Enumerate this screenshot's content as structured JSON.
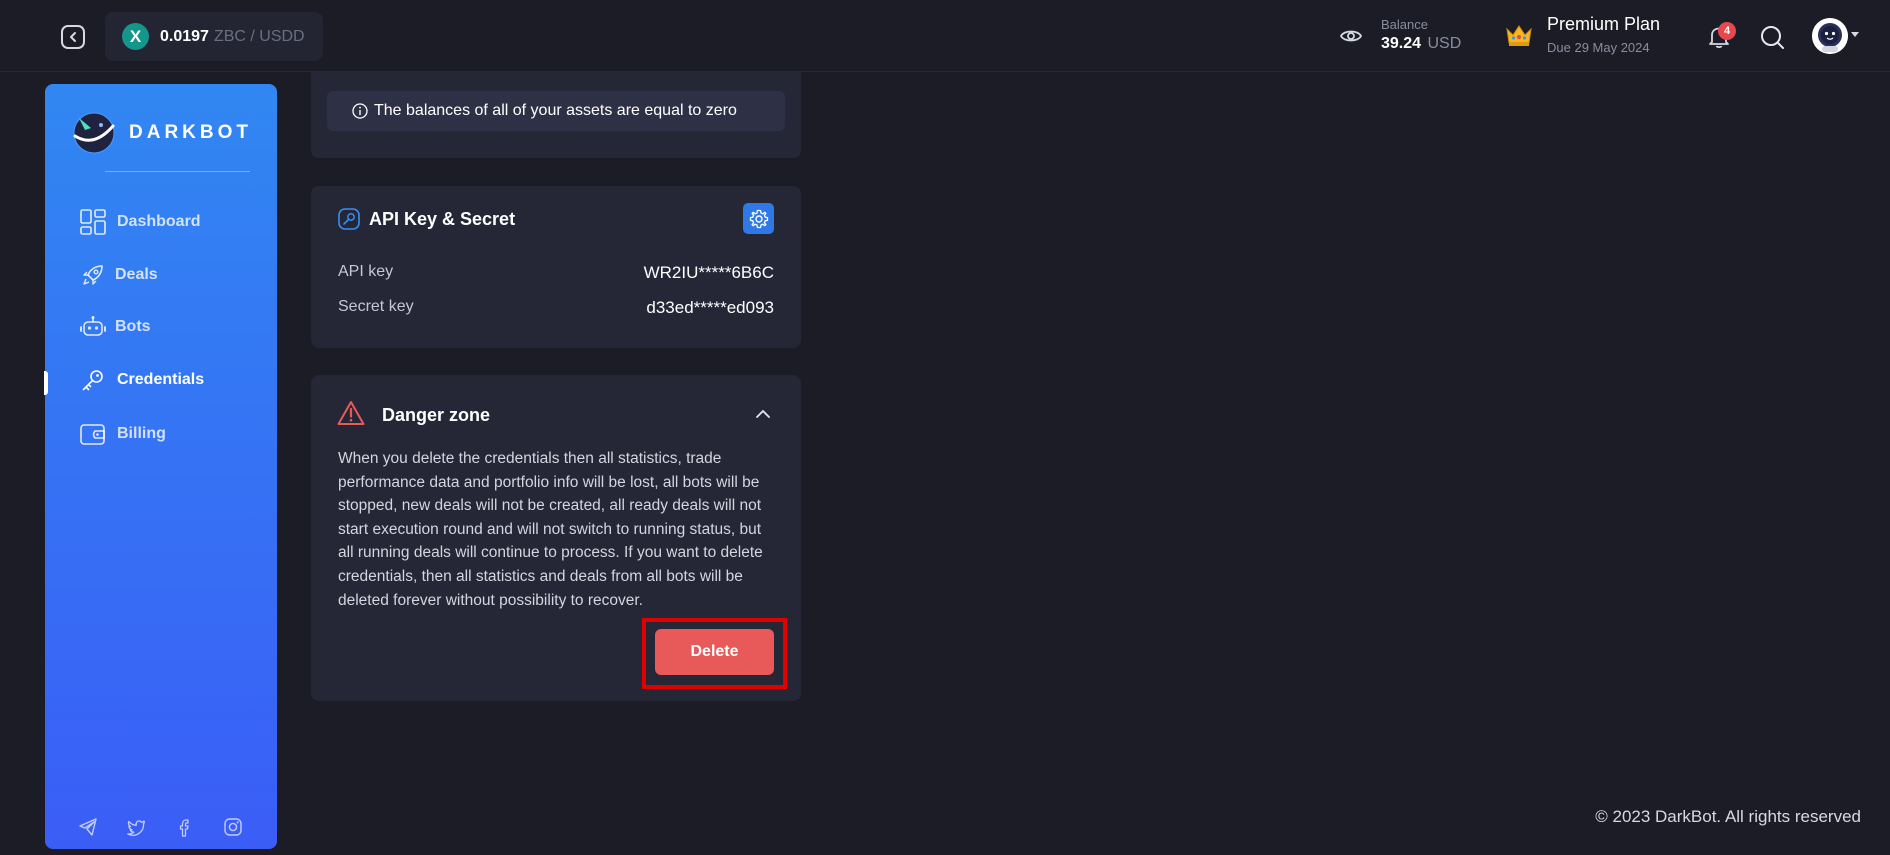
{
  "header": {
    "ticker": {
      "price": "0.0197",
      "pair": "ZBC / USDD",
      "coin_icon": "zbc-coin-icon",
      "coin_letter": "X"
    },
    "balance": {
      "label": "Balance",
      "value": "39.24",
      "currency": "USD"
    },
    "plan": {
      "name": "Premium Plan",
      "due": "Due 29 May 2024"
    },
    "notifications_count": "4"
  },
  "sidebar": {
    "brand": "DARKBOT",
    "items": [
      {
        "label": "Dashboard",
        "icon": "dashboard-icon"
      },
      {
        "label": "Deals",
        "icon": "rocket-icon"
      },
      {
        "label": "Bots",
        "icon": "robot-icon"
      },
      {
        "label": "Credentials",
        "icon": "key-icon",
        "active": true
      },
      {
        "label": "Billing",
        "icon": "wallet-icon"
      }
    ],
    "socials": [
      "telegram-icon",
      "twitter-icon",
      "facebook-icon",
      "instagram-icon"
    ]
  },
  "main": {
    "assets_notice": "The balances of all of your assets are equal to zero",
    "api": {
      "title": "API Key & Secret",
      "rows": [
        {
          "label": "API key",
          "value": "WR2IU*****6B6C"
        },
        {
          "label": "Secret key",
          "value": "d33ed*****ed093"
        }
      ]
    },
    "danger": {
      "title": "Danger zone",
      "text": "When you delete the credentials then all statistics, trade performance data and portfolio info will be lost, all bots will be stopped, new deals will not be created, all ready deals will not start execution round and will not switch to running status, but all running deals will continue to process. If you want to delete credentials, then all statistics and deals from all bots will be deleted forever without possibility to recover.",
      "delete_label": "Delete"
    }
  },
  "footer": {
    "copyright": "© 2023 DarkBot. All rights reserved"
  },
  "colors": {
    "accent": "#2f79e6",
    "danger": "#e85a5a",
    "background": "#1b1c26",
    "card": "#252737"
  }
}
